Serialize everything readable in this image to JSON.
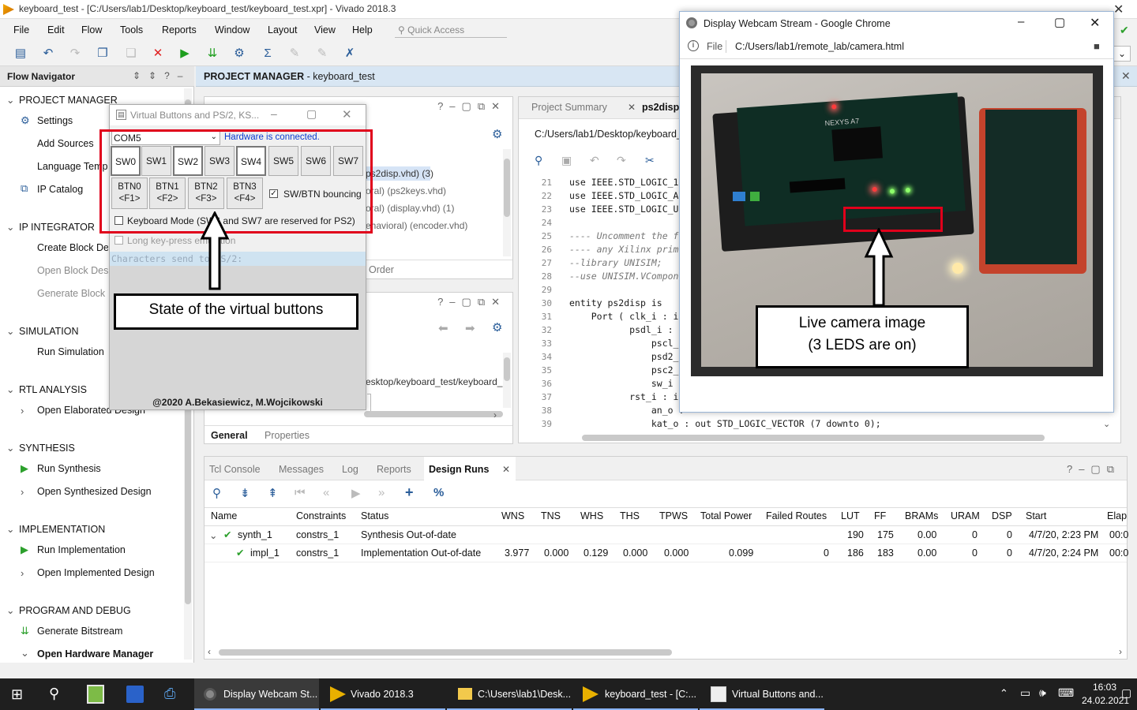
{
  "vivado": {
    "title": "keyboard_test - [C:/Users/lab1/Desktop/keyboard_test/keyboard_test.xpr] - Vivado 2018.3",
    "menu": [
      "File",
      "Edit",
      "Flow",
      "Tools",
      "Reports",
      "Window",
      "Layout",
      "View",
      "Help"
    ],
    "quick_access": "Quick Access",
    "flow_navigator": {
      "title": "Flow Navigator",
      "sections": [
        {
          "label": "PROJECT MANAGER",
          "items": [
            "Settings",
            "Add Sources",
            "Language Templates",
            "IP Catalog"
          ]
        },
        {
          "label": "IP INTEGRATOR",
          "items": [
            "Create Block Design",
            "Open Block Design",
            "Generate Block Design"
          ]
        },
        {
          "label": "SIMULATION",
          "items": [
            "Run Simulation"
          ]
        },
        {
          "label": "RTL ANALYSIS",
          "items": [
            "Open Elaborated Design"
          ]
        },
        {
          "label": "SYNTHESIS",
          "items": [
            "Run Synthesis",
            "Open Synthesized Design"
          ]
        },
        {
          "label": "IMPLEMENTATION",
          "items": [
            "Run Implementation",
            "Open Implemented Design"
          ]
        },
        {
          "label": "PROGRAM AND DEBUG",
          "items": [
            "Generate Bitstream",
            "Open Hardware Manager"
          ]
        }
      ]
    },
    "pm_header": {
      "bold": "PROJECT MANAGER",
      "rest": " - keyboard_test"
    },
    "sources": {
      "lines": [
        "ps2disp.vhd) (3)",
        "oral) (ps2keys.vhd)",
        "oral) (display.vhd) (1)",
        "ehavioral) (encoder.vhd)"
      ],
      "order_tab": "Order"
    },
    "props": {
      "path": "esktop/keyboard_test/keyboard_",
      "tabs": [
        "General",
        "Properties"
      ]
    },
    "editor": {
      "tabs": [
        "Project Summary",
        "ps2disp"
      ],
      "path": "C:/Users/lab1/Desktop/keyboard_",
      "lines": [
        {
          "n": "21",
          "code": "use IEEE.STD_LOGIC_1"
        },
        {
          "n": "22",
          "code": "use IEEE.STD_LOGIC_A"
        },
        {
          "n": "23",
          "code": "use IEEE.STD_LOGIC_U"
        },
        {
          "n": "24",
          "code": ""
        },
        {
          "n": "25",
          "code": "---- Uncomment the f"
        },
        {
          "n": "26",
          "code": "---- any Xilinx prim"
        },
        {
          "n": "27",
          "code": "--library UNISIM;"
        },
        {
          "n": "28",
          "code": "--use UNISIM.VCompon"
        },
        {
          "n": "29",
          "code": ""
        },
        {
          "n": "30",
          "code": "entity ps2disp is"
        },
        {
          "n": "31",
          "code": "    Port ( clk_i : i"
        },
        {
          "n": "32",
          "code": "           psdl_i :"
        },
        {
          "n": "33",
          "code": "               pscl_i"
        },
        {
          "n": "34",
          "code": "               psd2_i"
        },
        {
          "n": "35",
          "code": "               psc2_i"
        },
        {
          "n": "36",
          "code": "               sw_i :"
        },
        {
          "n": "37",
          "code": "           rst_i : i"
        },
        {
          "n": "38",
          "code": "               an_o :"
        },
        {
          "n": "39",
          "code": "               kat_o : out STD_LOGIC_VECTOR (7 downto 0);"
        }
      ]
    },
    "bottom": {
      "tabs": [
        "Tcl Console",
        "Messages",
        "Log",
        "Reports",
        "Design Runs"
      ],
      "columns": [
        "Name",
        "Constraints",
        "Status",
        "WNS",
        "TNS",
        "WHS",
        "THS",
        "TPWS",
        "Total Power",
        "Failed Routes",
        "LUT",
        "FF",
        "BRAMs",
        "URAM",
        "DSP",
        "Start",
        "Elap"
      ],
      "rows": [
        {
          "name": "synth_1",
          "constraints": "constrs_1",
          "status": "Synthesis Out-of-date",
          "wns": "",
          "tns": "",
          "whs": "",
          "ths": "",
          "tpws": "",
          "power": "",
          "failed": "",
          "lut": "190",
          "ff": "175",
          "brams": "0.00",
          "uram": "0",
          "dsp": "0",
          "start": "4/7/20, 2:23 PM",
          "elap": "00:0"
        },
        {
          "name": "impl_1",
          "constraints": "constrs_1",
          "status": "Implementation Out-of-date",
          "wns": "3.977",
          "tns": "0.000",
          "whs": "0.129",
          "ths": "0.000",
          "tpws": "0.000",
          "power": "0.099",
          "failed": "0",
          "lut": "186",
          "ff": "183",
          "brams": "0.00",
          "uram": "0",
          "dsp": "0",
          "start": "4/7/20, 2:24 PM",
          "elap": "00:0"
        }
      ]
    }
  },
  "virtual_buttons": {
    "title": "Virtual Buttons and PS/2, KS...",
    "com_port": "COM5",
    "hw_status": "Hardware is connected.",
    "switches": [
      {
        "label": "SW0",
        "on": true
      },
      {
        "label": "SW1",
        "on": false
      },
      {
        "label": "SW2",
        "on": true
      },
      {
        "label": "SW3",
        "on": false
      },
      {
        "label": "SW4",
        "on": true
      },
      {
        "label": "SW5",
        "on": false
      },
      {
        "label": "SW6",
        "on": false
      },
      {
        "label": "SW7",
        "on": false
      }
    ],
    "buttons": [
      "BTN0\n<F1>",
      "BTN1\n<F2>",
      "BTN2\n<F3>",
      "BTN3\n<F4>"
    ],
    "bouncing_label": "SW/BTN bouncing",
    "keyboard_mode": "Keyboard Mode (SW6 and SW7 are reserved for PS2)",
    "long_press": "Long key-press emulation",
    "chars_placeholder": "Characters send to PS/2:",
    "footer": "@2020 A.Bekasiewicz, M.Wojcikowski"
  },
  "annotations": {
    "virtual_buttons": "State of the virtual buttons",
    "camera_line1": "Live camera image",
    "camera_line2": "(3 LEDS are on)"
  },
  "chrome": {
    "title": "Display Webcam Stream - Google Chrome",
    "file_label": "File",
    "url": "C:/Users/lab1/remote_lab/camera.html",
    "board_label": "NEXYS A7"
  },
  "taskbar": {
    "tasks": [
      "Display Webcam St...",
      "Vivado 2018.3",
      "C:\\Users\\lab1\\Desk...",
      "keyboard_test - [C:...",
      "Virtual Buttons and..."
    ],
    "time": "16:03",
    "date": "24.02.2021"
  }
}
